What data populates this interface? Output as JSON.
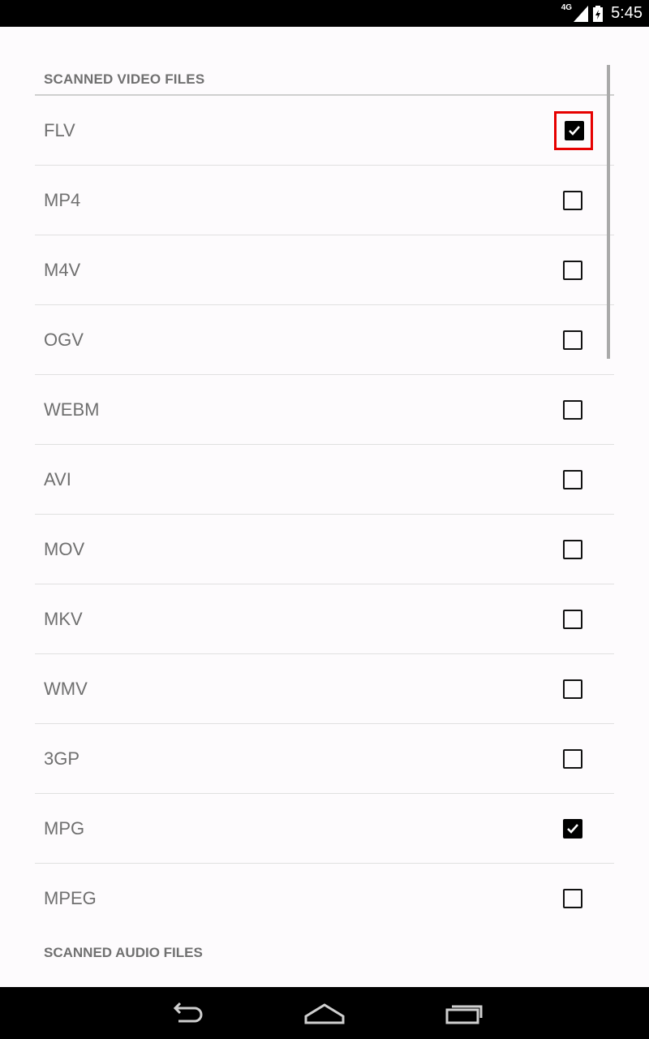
{
  "status_bar": {
    "network": "4G",
    "time": "5:45"
  },
  "settings": {
    "video_section_title": "SCANNED VIDEO FILES",
    "video_formats": [
      {
        "label": "FLV",
        "checked": true,
        "highlighted": true
      },
      {
        "label": "MP4",
        "checked": false
      },
      {
        "label": "M4V",
        "checked": false
      },
      {
        "label": "OGV",
        "checked": false
      },
      {
        "label": "WEBM",
        "checked": false
      },
      {
        "label": "AVI",
        "checked": false
      },
      {
        "label": "MOV",
        "checked": false
      },
      {
        "label": "MKV",
        "checked": false
      },
      {
        "label": "WMV",
        "checked": false
      },
      {
        "label": "3GP",
        "checked": false
      },
      {
        "label": "MPG",
        "checked": true
      },
      {
        "label": "MPEG",
        "checked": false
      }
    ],
    "audio_section_title": "SCANNED AUDIO FILES"
  },
  "nav_bar": {
    "back": "back-icon",
    "home": "home-icon",
    "recents": "recents-icon"
  },
  "colors": {
    "highlight": "#e60000",
    "checkbox": "#000000",
    "label": "#6f6f6f"
  }
}
